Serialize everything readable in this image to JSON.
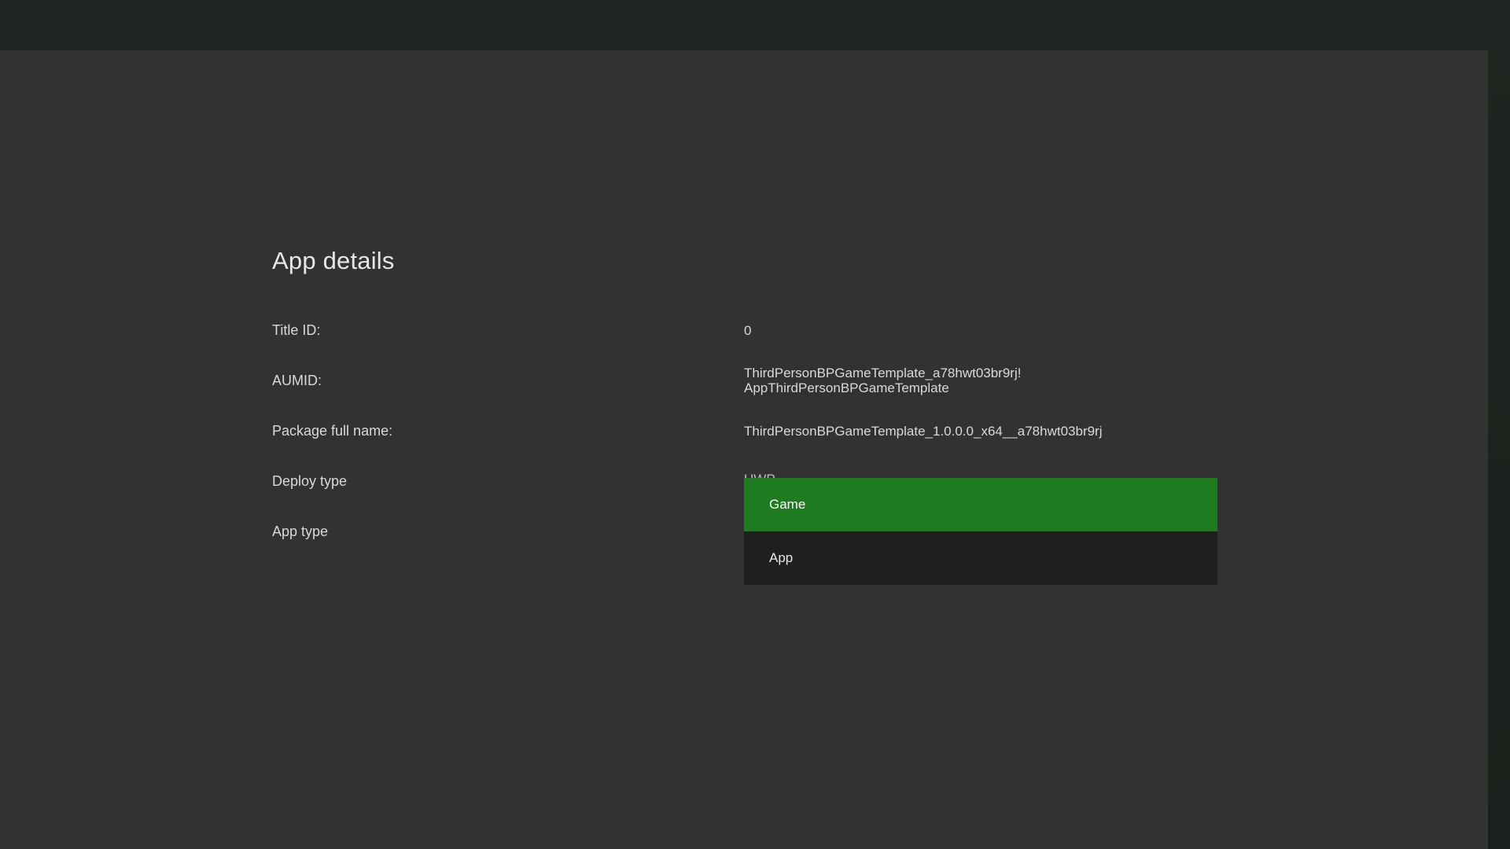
{
  "page": {
    "title": "App details"
  },
  "details": [
    {
      "label": "Title ID:",
      "value": "0"
    },
    {
      "label": "AUMID:",
      "value": "ThirdPersonBPGameTemplate_a78hwt03br9rj!\nAppThirdPersonBPGameTemplate"
    },
    {
      "label": "Package full name:",
      "value": "ThirdPersonBPGameTemplate_1.0.0.0_x64__a78hwt03br9rj"
    },
    {
      "label": "Deploy type",
      "value": "UWP"
    },
    {
      "label": "App type"
    }
  ],
  "app_type_dropdown": {
    "options": [
      "Game",
      "App"
    ],
    "selected": "Game"
  },
  "colors": {
    "panel_bg": "#323232",
    "selected_option": "#1e7b20",
    "dropdown_bg": "#1f1f1f"
  }
}
